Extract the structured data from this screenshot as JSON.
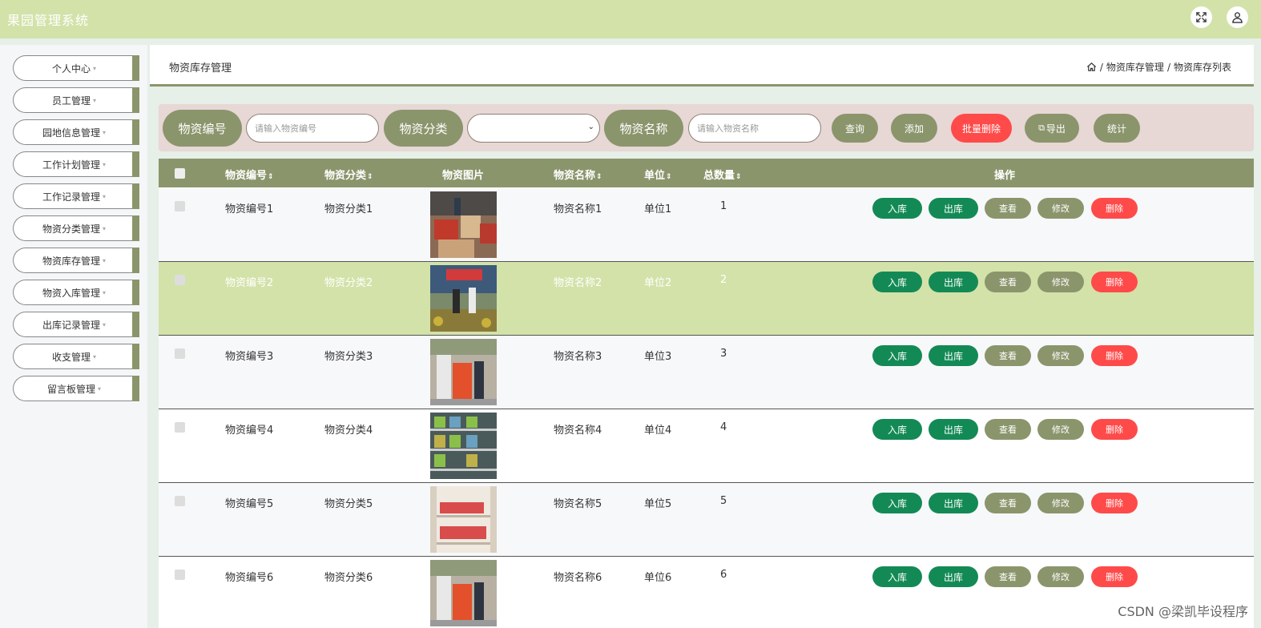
{
  "app": {
    "title": "果园管理系统"
  },
  "topbar": {
    "fullscreen_icon": "fullscreen-icon",
    "user_icon": "user-icon"
  },
  "sidebar": {
    "items": [
      {
        "label": "个人中心"
      },
      {
        "label": "员工管理"
      },
      {
        "label": "园地信息管理"
      },
      {
        "label": "工作计划管理"
      },
      {
        "label": "工作记录管理"
      },
      {
        "label": "物资分类管理"
      },
      {
        "label": "物资库存管理"
      },
      {
        "label": "物资入库管理"
      },
      {
        "label": "出库记录管理"
      },
      {
        "label": "收支管理"
      },
      {
        "label": "留言板管理"
      }
    ]
  },
  "header": {
    "title": "物资库存管理",
    "breadcrumb": [
      "物资库存管理",
      "物资库存列表"
    ],
    "sep": "/"
  },
  "search": {
    "code_label": "物资编号",
    "code_placeholder": "请输入物资编号",
    "category_label": "物资分类",
    "name_label": "物资名称",
    "name_placeholder": "请输入物资名称",
    "buttons": {
      "query": "查询",
      "add": "添加",
      "batch_delete": "批量删除",
      "export": "导出",
      "stats": "统计"
    }
  },
  "table": {
    "columns": [
      "物资编号",
      "物资分类",
      "物资图片",
      "物资名称",
      "单位",
      "总数量",
      "操作"
    ],
    "sort_glyph": "⇕",
    "rows": [
      {
        "code": "物资编号1",
        "category": "物资分类1",
        "name": "物资名称1",
        "unit": "单位1",
        "total": "1"
      },
      {
        "code": "物资编号2",
        "category": "物资分类2",
        "name": "物资名称2",
        "unit": "单位2",
        "total": "2"
      },
      {
        "code": "物资编号3",
        "category": "物资分类3",
        "name": "物资名称3",
        "unit": "单位3",
        "total": "3"
      },
      {
        "code": "物资编号4",
        "category": "物资分类4",
        "name": "物资名称4",
        "unit": "单位4",
        "total": "4"
      },
      {
        "code": "物资编号5",
        "category": "物资分类5",
        "name": "物资名称5",
        "unit": "单位5",
        "total": "5"
      },
      {
        "code": "物资编号6",
        "category": "物资分类6",
        "name": "物资名称6",
        "unit": "单位6",
        "total": "6"
      }
    ],
    "actions": {
      "in": "入库",
      "out": "出库",
      "view": "查看",
      "edit": "修改",
      "delete": "删除"
    }
  },
  "watermark": "CSDN @梁凯毕设程序"
}
